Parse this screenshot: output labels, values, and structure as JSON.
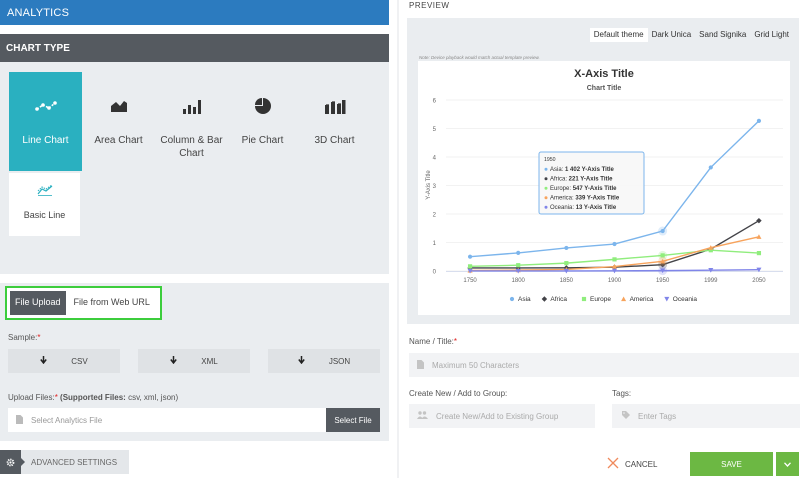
{
  "left": {
    "topbar_title": "ANALYTICS",
    "chart_type_title": "CHART TYPE",
    "chart_types": [
      {
        "label_1": "Line Chart",
        "label_2": "",
        "icon": "line-chart-icon"
      },
      {
        "label_1": "Area Chart",
        "label_2": "",
        "icon": "area-chart-icon"
      },
      {
        "label_1": "Column & Bar",
        "label_2": "Chart",
        "icon": "column-chart-icon"
      },
      {
        "label_1": "Pie Chart",
        "label_2": "",
        "icon": "pie-chart-icon"
      },
      {
        "label_1": "3D Chart",
        "label_2": "",
        "icon": "3d-chart-icon"
      }
    ],
    "subtype": {
      "label": "Basic Line",
      "icon": "basic-line-icon"
    },
    "upload_tabs": {
      "file_upload": "File Upload",
      "web_url": "File from Web URL"
    },
    "sample_label": "Sample:",
    "required_mark": "*",
    "samples": {
      "csv": "CSV",
      "xml": "XML",
      "json": "JSON"
    },
    "upload_files_label": "Upload Files:",
    "supported_files_label": "(Supported Files:",
    "supported_files_value": "csv, xml, json)",
    "file_placeholder": "Select Analytics File",
    "select_file": "Select File",
    "advanced": "ADVANCED SETTINGS"
  },
  "right": {
    "preview_label": "PREVIEW",
    "themes": [
      "Default theme",
      "Dark Unica",
      "Sand Signika",
      "Grid Light"
    ],
    "active_theme": "Default theme",
    "note": "Note: Device playback would match actual template preview.",
    "name_label": "Name / Title:",
    "name_placeholder": "Maximum 50 Characters",
    "group_label": "Create New / Add to Group:",
    "group_placeholder": "Create New/Add to Existing Group",
    "tags_label": "Tags:",
    "tags_placeholder": "Enter Tags",
    "cancel": "CANCEL",
    "save": "SAVE"
  },
  "chart_data": {
    "type": "line",
    "title": "X-Axis Title",
    "subtitle": "Chart Title",
    "ylabel": "Y-Axis Title",
    "xlabel": "",
    "categories": [
      "1750",
      "1800",
      "1850",
      "1900",
      "1950",
      "1999",
      "2050"
    ],
    "ylim": [
      0,
      6
    ],
    "yticks": [
      0,
      1,
      2,
      3,
      4,
      5,
      6
    ],
    "grid": true,
    "legend_position": "bottom",
    "series": [
      {
        "name": "Asia",
        "color": "#7cb5ec",
        "marker": "circle",
        "values": [
          0.502,
          0.635,
          0.809,
          0.947,
          1.402,
          3.634,
          5.268
        ]
      },
      {
        "name": "Africa",
        "color": "#434348",
        "marker": "diamond",
        "values": [
          0.106,
          0.107,
          0.111,
          0.133,
          0.221,
          0.767,
          1.766
        ]
      },
      {
        "name": "Europe",
        "color": "#90ed7d",
        "marker": "square",
        "values": [
          0.163,
          0.203,
          0.276,
          0.408,
          0.547,
          0.729,
          0.628
        ]
      },
      {
        "name": "America",
        "color": "#f7a35c",
        "marker": "triangle",
        "values": [
          0.018,
          0.031,
          0.054,
          0.156,
          0.339,
          0.818,
          1.201
        ]
      },
      {
        "name": "Oceania",
        "color": "#8085e9",
        "marker": "triangle-down",
        "values": [
          0.002,
          0.002,
          0.002,
          0.006,
          0.013,
          0.03,
          0.046
        ]
      }
    ],
    "tooltip": {
      "header": "1950",
      "rows": [
        {
          "series": "Asia",
          "value": "1 402",
          "suffix": "Y-Axis Title"
        },
        {
          "series": "Africa",
          "value": "221",
          "suffix": "Y-Axis Title"
        },
        {
          "series": "Europe",
          "value": "547",
          "suffix": "Y-Axis Title"
        },
        {
          "series": "America",
          "value": "339",
          "suffix": "Y-Axis Title"
        },
        {
          "series": "Oceania",
          "value": "13",
          "suffix": "Y-Axis Title"
        }
      ]
    }
  }
}
